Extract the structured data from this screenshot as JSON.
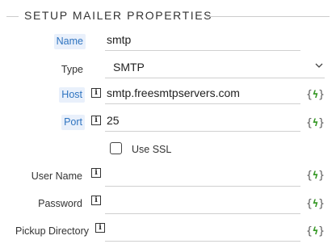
{
  "section": {
    "title": "SETUP MAILER PROPERTIES"
  },
  "fields": {
    "name": {
      "label": "Name",
      "value": "smtp"
    },
    "type": {
      "label": "Type",
      "value": "SMTP"
    },
    "host": {
      "label": "Host",
      "value": "smtp.freesmtpservers.com"
    },
    "port": {
      "label": "Port",
      "value": "25"
    },
    "use_ssl": {
      "label": "Use SSL",
      "checked": false
    },
    "user_name": {
      "label": "User Name",
      "value": ""
    },
    "password": {
      "label": "Password",
      "value": ""
    },
    "pickup_directory": {
      "label": "Pickup Directory",
      "value": ""
    }
  },
  "icons": {
    "info": "info-icon",
    "binding": "expression-binding-icon",
    "dropdown": "chevron-down-icon"
  },
  "colors": {
    "highlight_bg": "#e9f0fb",
    "highlight_text": "#2f74c0",
    "bolt": "#3a9a2a"
  }
}
